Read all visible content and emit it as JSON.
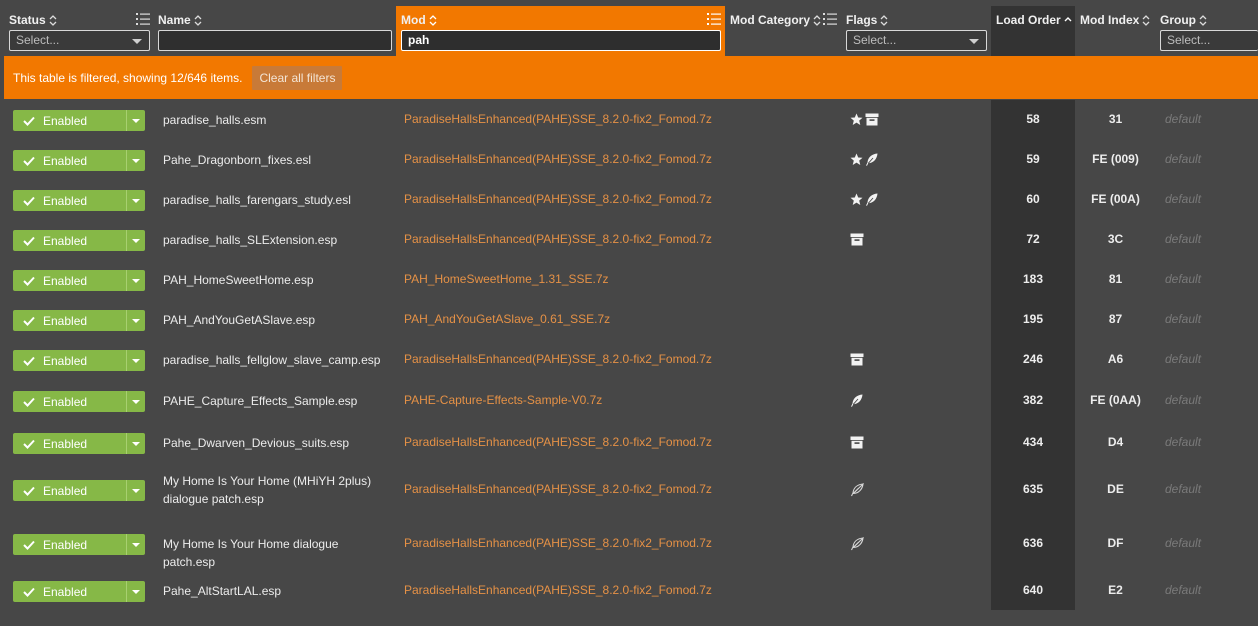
{
  "columns": {
    "status": {
      "label": "Status",
      "filter_placeholder": "Select..."
    },
    "name": {
      "label": "Name",
      "filter_value": ""
    },
    "mod": {
      "label": "Mod",
      "filter_value": "pah"
    },
    "mod_category": {
      "label": "Mod Category"
    },
    "flags": {
      "label": "Flags",
      "filter_placeholder": "Select..."
    },
    "load_order": {
      "label": "Load Order",
      "sort": "ascending"
    },
    "mod_index": {
      "label": "Mod Index"
    },
    "group": {
      "label": "Group",
      "filter_placeholder": "Select..."
    }
  },
  "banner": {
    "message": "This table is filtered, showing 12/646 items.",
    "clear_label": "Clear all filters"
  },
  "colors": {
    "accent": "#f27800",
    "enabled": "#86b847",
    "mod_link": "#e59146"
  },
  "rows": [
    {
      "status": "Enabled",
      "name": "paradise_halls.esm",
      "mod": "ParadiseHallsEnhanced(PAHE)SSE_8.2.0-fix2_Fomod.7z",
      "flags": [
        "star-icon",
        "archive-icon"
      ],
      "load_order": "58",
      "mod_index": "31",
      "group": "default"
    },
    {
      "status": "Enabled",
      "name": "Pahe_Dragonborn_fixes.esl",
      "mod": "ParadiseHallsEnhanced(PAHE)SSE_8.2.0-fix2_Fomod.7z",
      "flags": [
        "star-icon",
        "feather-icon"
      ],
      "load_order": "59",
      "mod_index": "FE (009)",
      "group": "default"
    },
    {
      "status": "Enabled",
      "name": "paradise_halls_farengars_study.esl",
      "mod": "ParadiseHallsEnhanced(PAHE)SSE_8.2.0-fix2_Fomod.7z",
      "flags": [
        "star-icon",
        "feather-icon"
      ],
      "load_order": "60",
      "mod_index": "FE (00A)",
      "group": "default"
    },
    {
      "status": "Enabled",
      "name": "paradise_halls_SLExtension.esp",
      "mod": "ParadiseHallsEnhanced(PAHE)SSE_8.2.0-fix2_Fomod.7z",
      "flags": [
        "archive-icon"
      ],
      "load_order": "72",
      "mod_index": "3C",
      "group": "default"
    },
    {
      "status": "Enabled",
      "name": "PAH_HomeSweetHome.esp",
      "mod": "PAH_HomeSweetHome_1.31_SSE.7z",
      "flags": [],
      "load_order": "183",
      "mod_index": "81",
      "group": "default"
    },
    {
      "status": "Enabled",
      "name": "PAH_AndYouGetASlave.esp",
      "mod": "PAH_AndYouGetASlave_0.61_SSE.7z",
      "flags": [],
      "load_order": "195",
      "mod_index": "87",
      "group": "default"
    },
    {
      "status": "Enabled",
      "name": "paradise_halls_fellglow_slave_camp.esp",
      "mod": "ParadiseHallsEnhanced(PAHE)SSE_8.2.0-fix2_Fomod.7z",
      "flags": [
        "archive-icon"
      ],
      "load_order": "246",
      "mod_index": "A6",
      "group": "default"
    },
    {
      "status": "Enabled",
      "name": "PAHE_Capture_Effects_Sample.esp",
      "mod": "PAHE-Capture-Effects-Sample-V0.7z",
      "flags": [
        "feather-icon"
      ],
      "load_order": "382",
      "mod_index": "FE (0AA)",
      "group": "default"
    },
    {
      "status": "Enabled",
      "name": "Pahe_Dwarven_Devious_suits.esp",
      "mod": "ParadiseHallsEnhanced(PAHE)SSE_8.2.0-fix2_Fomod.7z",
      "flags": [
        "archive-icon"
      ],
      "load_order": "434",
      "mod_index": "D4",
      "group": "default"
    },
    {
      "status": "Enabled",
      "name": "My Home Is Your Home (MHiYH 2plus) dialogue patch.esp",
      "mod": "ParadiseHallsEnhanced(PAHE)SSE_8.2.0-fix2_Fomod.7z",
      "flags": [
        "feather-outline-icon"
      ],
      "load_order": "635",
      "mod_index": "DE",
      "group": "default"
    },
    {
      "status": "Enabled",
      "name": "My Home Is Your Home dialogue patch.esp",
      "mod": "ParadiseHallsEnhanced(PAHE)SSE_8.2.0-fix2_Fomod.7z",
      "flags": [
        "feather-outline-icon"
      ],
      "load_order": "636",
      "mod_index": "DF",
      "group": "default"
    },
    {
      "status": "Enabled",
      "name": "Pahe_AltStartLAL.esp",
      "mod": "ParadiseHallsEnhanced(PAHE)SSE_8.2.0-fix2_Fomod.7z",
      "flags": [],
      "load_order": "640",
      "mod_index": "E2",
      "group": "default"
    }
  ]
}
